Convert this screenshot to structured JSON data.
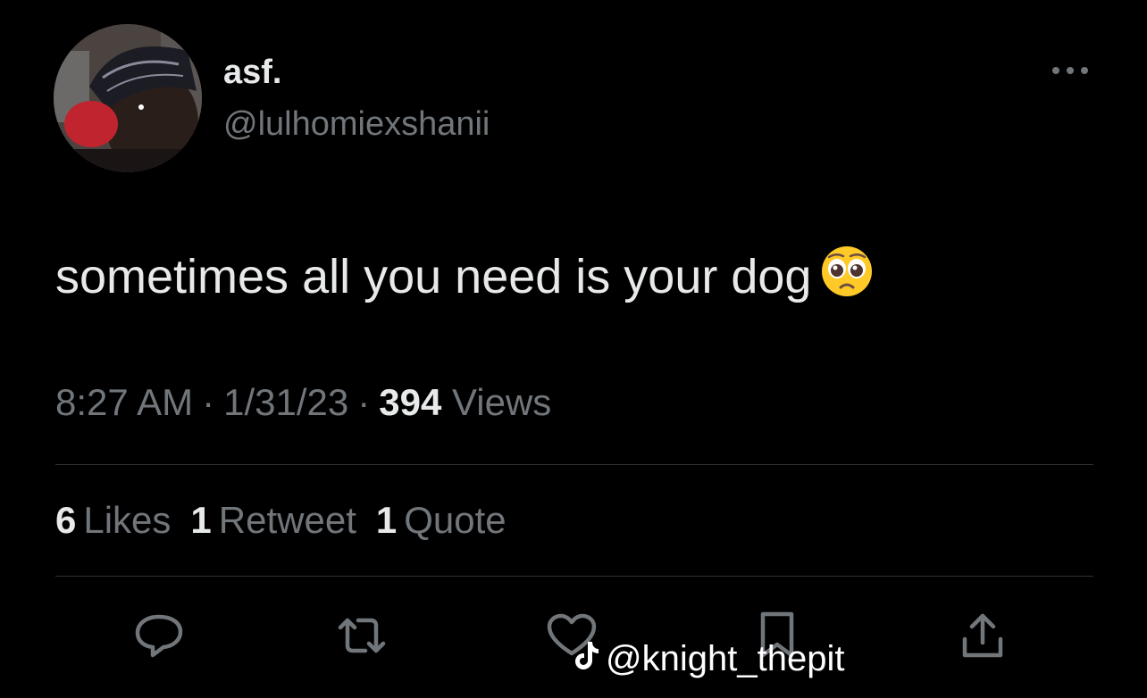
{
  "tweet": {
    "display_name": "asf.",
    "handle": "@lulhomiexshanii",
    "text": "sometimes all you need is your dog",
    "emoji": "pleading-face",
    "time": "8:27 AM",
    "date": "1/31/23",
    "views_count": "394",
    "views_label": "Views",
    "separator": "·"
  },
  "stats": {
    "likes_count": "6",
    "likes_label": "Likes",
    "retweets_count": "1",
    "retweets_label": "Retweet",
    "quotes_count": "1",
    "quotes_label": "Quote"
  },
  "actions": {
    "icons": [
      "reply-icon",
      "retweet-icon",
      "like-icon",
      "bookmark-icon",
      "share-icon"
    ]
  },
  "watermark": {
    "text": "@knight_thepit",
    "icon": "tiktok-icon"
  },
  "colors": {
    "background": "#000000",
    "primary_text": "#e7e9ea",
    "secondary_text": "#71767b",
    "divider": "#2f3336"
  }
}
